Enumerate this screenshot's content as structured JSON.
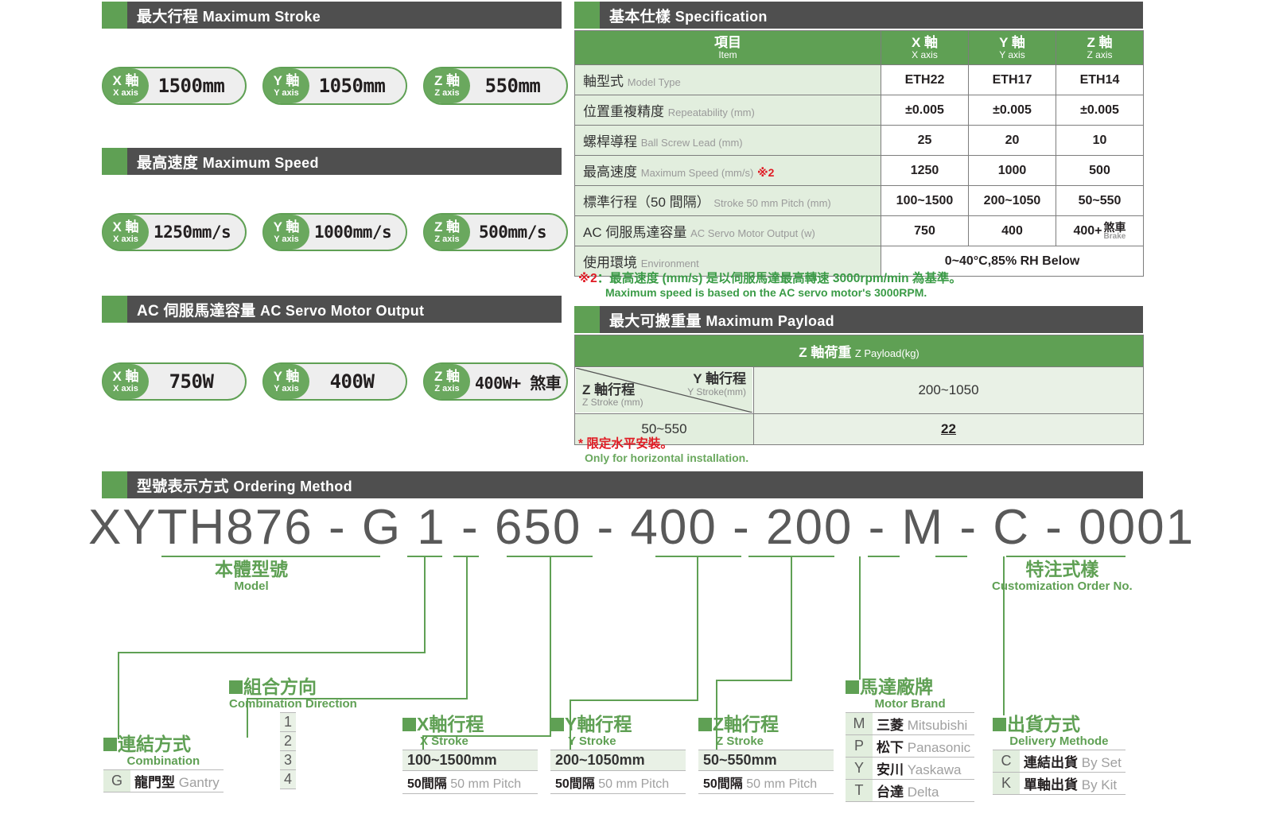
{
  "sections": {
    "max_stroke": {
      "cn": "最大行程",
      "en": "Maximum Stroke"
    },
    "max_speed": {
      "cn": "最高速度",
      "en": "Maximum Speed"
    },
    "motor_output": {
      "cn": "AC 伺服馬達容量",
      "en": "AC Servo Motor Output"
    },
    "specification": {
      "cn": "基本仕樣",
      "en": "Specification"
    },
    "max_payload": {
      "cn": "最大可搬重量",
      "en": "Maximum Payload"
    },
    "ordering": {
      "cn": "型號表示方式",
      "en": "Ordering Method"
    }
  },
  "axis_labels": {
    "x": {
      "cn": "X 軸",
      "en": "X axis"
    },
    "y": {
      "cn": "Y 軸",
      "en": "Y axis"
    },
    "z": {
      "cn": "Z 軸",
      "en": "Z axis"
    }
  },
  "badges": {
    "stroke": [
      "1500mm",
      "1050mm",
      "550mm"
    ],
    "speed": [
      "1250mm/s",
      "1000mm/s",
      "500mm/s"
    ],
    "motor": [
      "750W",
      "400W",
      "400W+ 煞車"
    ]
  },
  "spec_table": {
    "header": {
      "item": {
        "cn": "項目",
        "en": "Item"
      },
      "x": {
        "cn": "X 軸",
        "en": "X axis"
      },
      "y": {
        "cn": "Y 軸",
        "en": "Y axis"
      },
      "z": {
        "cn": "Z 軸",
        "en": "Z axis"
      }
    },
    "rows": [
      {
        "cn": "軸型式",
        "en": "Model Type",
        "x": "ETH22",
        "y": "ETH17",
        "z": "ETH14"
      },
      {
        "cn": "位置重複精度",
        "en": "Repeatability (mm)",
        "x": "±0.005",
        "y": "±0.005",
        "z": "±0.005"
      },
      {
        "cn": "螺桿導程",
        "en": "Ball Screw Lead (mm)",
        "x": "25",
        "y": "20",
        "z": "10"
      },
      {
        "cn": "最高速度",
        "en": "Maximum Speed (mm/s)",
        "mark": "※2",
        "x": "1250",
        "y": "1000",
        "z": "500"
      },
      {
        "cn": "標準行程（50 間隔）",
        "en": "Stroke 50 mm Pitch (mm)",
        "x": "100~1500",
        "y": "200~1050",
        "z": "50~550"
      },
      {
        "cn": "AC 伺服馬達容量",
        "en": "AC Servo Motor Output (w)",
        "x": "750",
        "y": "400",
        "z": "400+",
        "z_brake_cn": "煞車",
        "z_brake_en": "Brake"
      }
    ],
    "environment": {
      "cn": "使用環境",
      "en": "Environment",
      "value": "0~40°C,85% RH Below"
    }
  },
  "note_speed": {
    "mark": "※2",
    "cn": "：最高速度 (mm/s) 是以伺服馬達最高轉速 3000rpm/min 為基準。",
    "en": "Maximum speed is based on the AC servo motor's 3000RPM."
  },
  "payload_table": {
    "header": {
      "cn": "Z 軸荷重",
      "en": "Z Payload(kg)"
    },
    "z_stroke_label": {
      "cn": "Z 軸行程",
      "en": "Z Stroke (mm)"
    },
    "y_stroke_label": {
      "cn": "Y 軸行程",
      "en": "Y Stroke(mm)"
    },
    "y_range": "200~1050",
    "z_range": "50~550",
    "value": "22"
  },
  "note_horizontal": {
    "cn": "* 限定水平安裝。",
    "en": "Only for horizontal installation."
  },
  "order_code": "XYTH876 - G 1 - 650 - 400 - 200 - M - C - 0001",
  "legends": {
    "model": {
      "cn": "本體型號",
      "en": "Model"
    },
    "customization": {
      "cn": "特注式樣",
      "en": "Customization Order No."
    },
    "combination": {
      "cn": "連結方式",
      "en": "Combination",
      "rows": [
        {
          "key": "G",
          "cn": "龍門型",
          "en": "Gantry"
        }
      ]
    },
    "comb_direction": {
      "cn": "組合方向",
      "en": "Combination Direction",
      "rows": [
        "1",
        "2",
        "3",
        "4"
      ]
    },
    "x_stroke": {
      "cn": "X軸行程",
      "en": "X Stroke",
      "range": "100~1500mm",
      "pitch_cn": "50間隔",
      "pitch_en": "50 mm Pitch"
    },
    "y_stroke": {
      "cn": "Y軸行程",
      "en": "Y Stroke",
      "range": "200~1050mm",
      "pitch_cn": "50間隔",
      "pitch_en": "50 mm Pitch"
    },
    "z_stroke": {
      "cn": "Z軸行程",
      "en": "Z Stroke",
      "range": "50~550mm",
      "pitch_cn": "50間隔",
      "pitch_en": "50 mm Pitch"
    },
    "motor_brand": {
      "cn": "馬達廠牌",
      "en": "Motor Brand",
      "rows": [
        {
          "key": "M",
          "cn": "三菱",
          "en": "Mitsubishi"
        },
        {
          "key": "P",
          "cn": "松下",
          "en": "Panasonic"
        },
        {
          "key": "Y",
          "cn": "安川",
          "en": "Yaskawa"
        },
        {
          "key": "T",
          "cn": "台達",
          "en": "Delta"
        }
      ]
    },
    "delivery": {
      "cn": "出貨方式",
      "en": "Delivery Methode",
      "rows": [
        {
          "key": "C",
          "cn": "連結出貨",
          "en": "By Set"
        },
        {
          "key": "K",
          "cn": "單軸出貨",
          "en": "By Kit"
        }
      ]
    }
  },
  "colors": {
    "green": "#5fa054",
    "dark_bar": "#4f4f4f",
    "red": "#e01b24",
    "light_green": "#e2eede"
  }
}
